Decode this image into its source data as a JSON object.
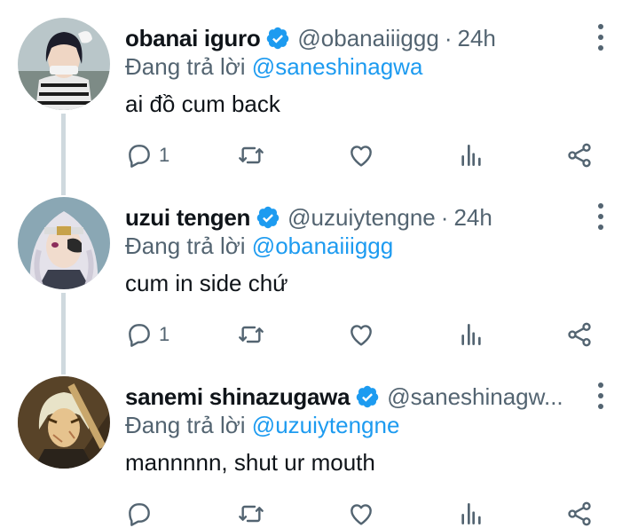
{
  "colors": {
    "text_primary": "#0f1419",
    "text_secondary": "#536471",
    "link": "#1d9bf0",
    "verified": "#1d9bf0",
    "thread_line": "#cfd9de"
  },
  "reply_prefix": "Đang trả lời",
  "tweets": [
    {
      "name": "obanai iguro",
      "handle": "@obanaiiiggg",
      "separator": "·",
      "time": "24h",
      "reply_to": "@saneshinagwa",
      "text": "ai đồ cum back",
      "reply_count": "1",
      "avatar": "obanai-avatar"
    },
    {
      "name": "uzui tengen",
      "handle": "@uzuiytengne",
      "separator": "·",
      "time": "24h",
      "reply_to": "@obanaiiiggg",
      "text": "cum in side chứ",
      "reply_count": "1",
      "avatar": "uzui-avatar"
    },
    {
      "name": "sanemi shinazugawa",
      "handle": "@saneshinagw...",
      "separator": "",
      "time": "",
      "reply_to": "@uzuiytengne",
      "text": "mannnnn, shut ur mouth",
      "reply_count": "",
      "avatar": "sanemi-avatar"
    }
  ],
  "icons": [
    "reply-icon",
    "retweet-icon",
    "like-icon",
    "views-icon",
    "share-icon",
    "more-icon",
    "verified-icon"
  ]
}
